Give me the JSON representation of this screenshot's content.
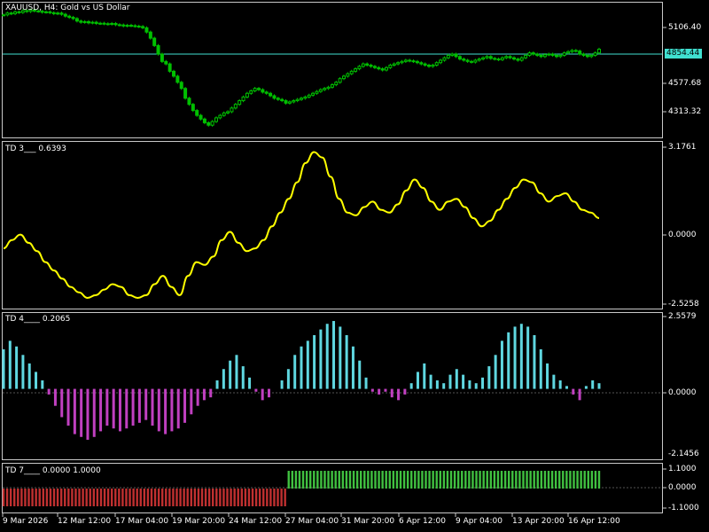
{
  "main_pane": {
    "title": "XAUUSD, H4:  Gold vs US Dollar",
    "price_levels": [
      "5106.40",
      "4577.68",
      "4313.32"
    ],
    "current_price": "4854.44",
    "colors": {
      "bull": "#00c000",
      "bear": "#00c000",
      "price_line": "#40e0d0"
    }
  },
  "panes": [
    {
      "title": "TD 3___ 0.6393",
      "levels": [
        "3.1761",
        "0.0000",
        "-2.5258"
      ],
      "color": "#ffff00"
    },
    {
      "title": "TD 4____ 0.2065",
      "levels": [
        "2.5579",
        "0.0000",
        "-2.1456"
      ],
      "colors": {
        "pos": "#5fd7e0",
        "neg": "#c040c0"
      }
    },
    {
      "title": "TD 7____ 0.0000 1.0000",
      "levels": [
        "1.1000",
        "0.0000",
        "-1.1000"
      ],
      "colors": {
        "pos": "#40c040",
        "neg": "#c03030"
      }
    }
  ],
  "time_axis": [
    "9 Mar 2026",
    "12 Mar 12:00",
    "17 Mar 04:00",
    "19 Mar 20:00",
    "24 Mar 12:00",
    "27 Mar 04:00",
    "31 Mar 20:00",
    "6 Apr 12:00",
    "9 Apr 04:00",
    "13 Apr 20:00",
    "16 Apr 12:00"
  ],
  "chart_data": [
    {
      "type": "line",
      "title": "XAUUSD, H4:  Gold vs US Dollar",
      "note": "candlestick close series (approx)",
      "y": [
        5200,
        5215,
        5210,
        5225,
        5220,
        5235,
        5228,
        5240,
        5232,
        5230,
        5222,
        5225,
        5218,
        5210,
        5215,
        5205,
        5190,
        5180,
        5170,
        5150,
        5140,
        5145,
        5135,
        5140,
        5130,
        5132,
        5128,
        5125,
        5130,
        5120,
        5118,
        5110,
        5115,
        5112,
        5108,
        5105,
        5095,
        5060,
        5010,
        4950,
        4880,
        4820,
        4800,
        4740,
        4700,
        4650,
        4600,
        4520,
        4470,
        4420,
        4380,
        4350,
        4320,
        4300,
        4330,
        4360,
        4380,
        4400,
        4410,
        4440,
        4470,
        4500,
        4530,
        4560,
        4580,
        4600,
        4590,
        4570,
        4560,
        4540,
        4520,
        4510,
        4500,
        4480,
        4490,
        4500,
        4510,
        4520,
        4530,
        4545,
        4560,
        4575,
        4590,
        4600,
        4610,
        4630,
        4650,
        4680,
        4700,
        4720,
        4740,
        4760,
        4780,
        4800,
        4790,
        4780,
        4770,
        4760,
        4750,
        4770,
        4790,
        4800,
        4810,
        4820,
        4830,
        4825,
        4820,
        4810,
        4800,
        4790,
        4780,
        4790,
        4810,
        4830,
        4850,
        4870,
        4880,
        4860,
        4840,
        4830,
        4820,
        4815,
        4830,
        4840,
        4850,
        4860,
        4845,
        4840,
        4835,
        4850,
        4860,
        4850,
        4840,
        4830,
        4850,
        4870,
        4890,
        4880,
        4870,
        4860,
        4875,
        4880,
        4870,
        4860,
        4870,
        4890,
        4900,
        4910,
        4905,
        4880,
        4870,
        4860,
        4870,
        4890,
        4920
      ],
      "ylim": [
        4200,
        5300
      ]
    },
    {
      "type": "line",
      "title": "TD 3___ 0.6393",
      "y": [
        -0.5,
        -0.2,
        0.0,
        -0.3,
        -0.6,
        -1.0,
        -1.3,
        -1.6,
        -1.9,
        -2.1,
        -2.3,
        -2.2,
        -2.0,
        -1.8,
        -1.9,
        -2.2,
        -2.3,
        -2.2,
        -1.8,
        -1.5,
        -1.9,
        -2.2,
        -1.5,
        -1.0,
        -1.1,
        -0.8,
        -0.2,
        0.1,
        -0.3,
        -0.6,
        -0.5,
        -0.2,
        0.3,
        0.8,
        1.3,
        1.9,
        2.6,
        3.0,
        2.8,
        2.1,
        1.3,
        0.8,
        0.7,
        1.0,
        1.2,
        0.9,
        0.8,
        1.1,
        1.6,
        2.0,
        1.7,
        1.2,
        0.9,
        1.2,
        1.3,
        1.0,
        0.6,
        0.3,
        0.5,
        0.9,
        1.3,
        1.7,
        2.0,
        1.9,
        1.5,
        1.2,
        1.4,
        1.5,
        1.2,
        0.9,
        0.8,
        0.6
      ],
      "ylim": [
        -2.5258,
        3.1761
      ]
    },
    {
      "type": "bar",
      "title": "TD 4____ 0.2065",
      "values": [
        1.4,
        1.7,
        1.5,
        1.2,
        0.9,
        0.6,
        0.3,
        -0.2,
        -0.6,
        -1.0,
        -1.3,
        -1.6,
        -1.7,
        -1.8,
        -1.7,
        -1.5,
        -1.3,
        -1.4,
        -1.5,
        -1.4,
        -1.3,
        -1.2,
        -1.1,
        -1.3,
        -1.5,
        -1.6,
        -1.5,
        -1.4,
        -1.2,
        -0.9,
        -0.6,
        -0.4,
        -0.3,
        0.3,
        0.7,
        1.0,
        1.2,
        0.8,
        0.4,
        -0.1,
        -0.4,
        -0.3,
        0.0,
        0.3,
        0.7,
        1.2,
        1.5,
        1.7,
        1.9,
        2.1,
        2.3,
        2.4,
        2.2,
        1.9,
        1.5,
        1.0,
        0.4,
        -0.1,
        -0.2,
        -0.1,
        -0.3,
        -0.4,
        -0.2,
        0.2,
        0.6,
        0.9,
        0.5,
        0.3,
        0.2,
        0.5,
        0.7,
        0.5,
        0.3,
        0.2,
        0.4,
        0.8,
        1.2,
        1.7,
        2.0,
        2.2,
        2.3,
        2.2,
        1.9,
        1.4,
        0.9,
        0.5,
        0.3,
        0.1,
        -0.2,
        -0.4,
        0.1,
        0.3,
        0.2
      ],
      "ylim": [
        -2.1456,
        2.5579
      ]
    },
    {
      "type": "bar",
      "title": "TD 7____ 0.0000 1.0000",
      "description": "binary histogram: -1 until 27 Mar 04:00, then +1",
      "values_first": -1,
      "values_second": 1,
      "switch_fraction": 0.475,
      "ylim": [
        -1.1,
        1.1
      ]
    }
  ]
}
